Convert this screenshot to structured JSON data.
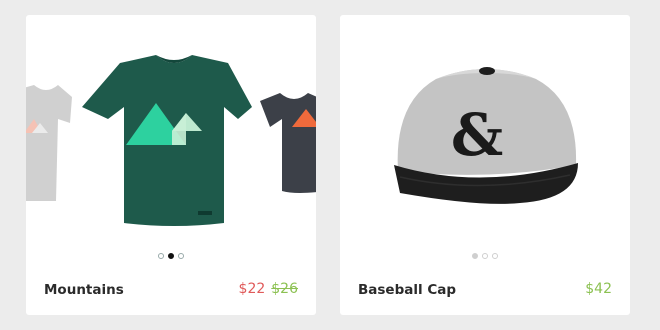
{
  "products": [
    {
      "name": "Mountains",
      "price_sale": "$22",
      "price_original": "$26",
      "image": "green-tshirt-mountains",
      "carousel_dots": 3,
      "carousel_active": 1
    },
    {
      "name": "Baseball Cap",
      "price": "$42",
      "image": "grey-black-baseball-cap-ampersand",
      "carousel_dots": 3,
      "carousel_active": 0
    }
  ],
  "colors": {
    "sale_price": "#e05a5a",
    "price": "#8cc152",
    "background": "#ececec"
  }
}
